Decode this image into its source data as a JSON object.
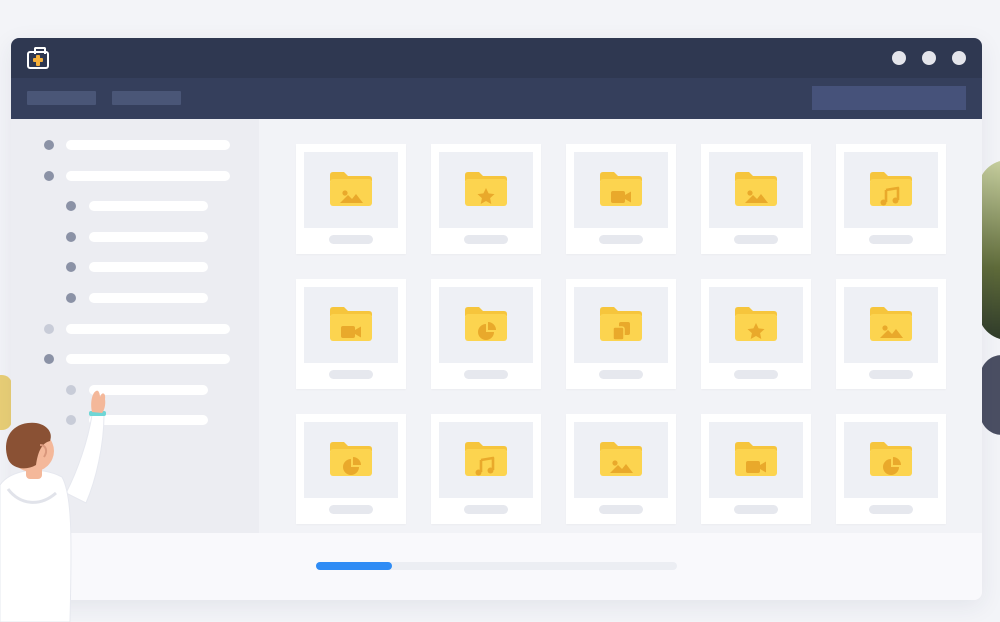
{
  "colors": {
    "titlebar": "#2f3851",
    "toolbar": "#353f5c",
    "folder": "#fcd44f",
    "folder_tab": "#f6c53c",
    "folder_glyph": "#e9a92b",
    "progress": "#2f8cf5"
  },
  "titlebar": {
    "app_icon": "medical-kit-icon",
    "window_controls": [
      "minimize-icon",
      "maximize-icon",
      "close-icon"
    ]
  },
  "sidebar": {
    "items": [
      {
        "level": 0,
        "state": "normal"
      },
      {
        "level": 0,
        "state": "normal"
      },
      {
        "level": 1,
        "state": "normal"
      },
      {
        "level": 1,
        "state": "normal"
      },
      {
        "level": 1,
        "state": "normal"
      },
      {
        "level": 1,
        "state": "normal"
      },
      {
        "level": 0,
        "state": "muted"
      },
      {
        "level": 0,
        "state": "normal"
      },
      {
        "level": 1,
        "state": "muted"
      },
      {
        "level": 1,
        "state": "muted"
      }
    ]
  },
  "folders": [
    {
      "icon": "image"
    },
    {
      "icon": "star"
    },
    {
      "icon": "video"
    },
    {
      "icon": "image"
    },
    {
      "icon": "music"
    },
    {
      "icon": "video"
    },
    {
      "icon": "pie-chart"
    },
    {
      "icon": "copy"
    },
    {
      "icon": "star"
    },
    {
      "icon": "image"
    },
    {
      "icon": "pie-chart"
    },
    {
      "icon": "music"
    },
    {
      "icon": "image"
    },
    {
      "icon": "video"
    },
    {
      "icon": "pie-chart"
    }
  ],
  "progress": {
    "fraction": 0.21
  }
}
